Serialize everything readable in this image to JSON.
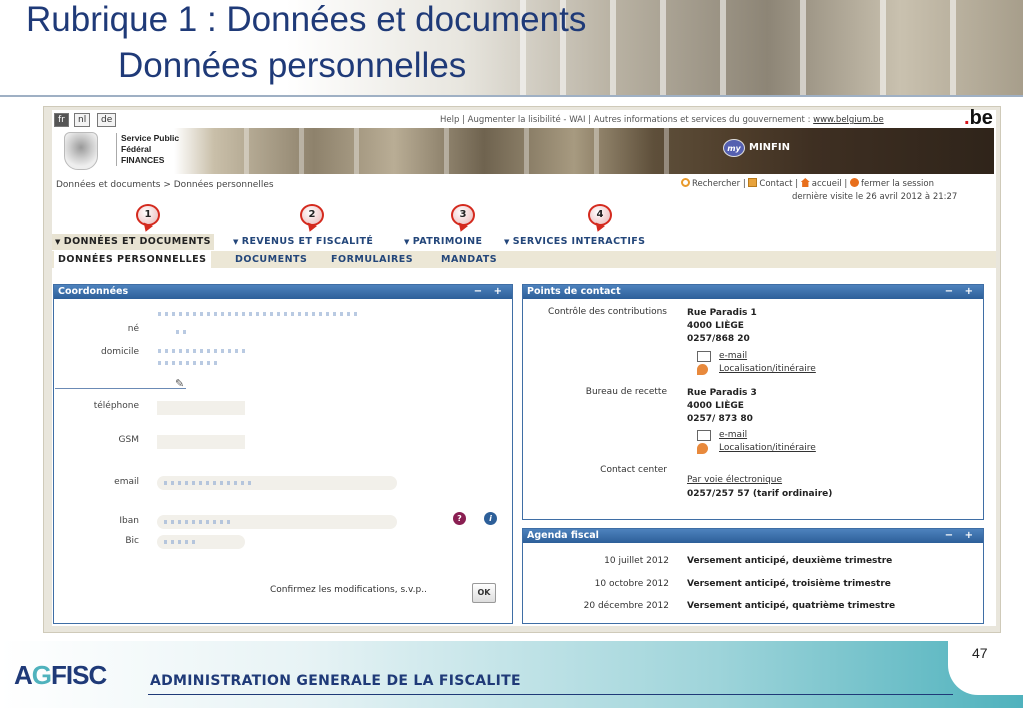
{
  "slide": {
    "title": "Rubrique 1 : Données et documents",
    "subtitle": "Données personnelles",
    "number": "47",
    "footer_logo": "AGFISC",
    "footer_agency": "ADMINISTRATION GENERALE DE LA FISCALITE"
  },
  "site": {
    "languages": [
      "fr",
      "nl",
      "de"
    ],
    "active_language": "fr",
    "top_links": "Help | Augmenter la lisibilité - WAI | Autres informations et services du gouvernement :",
    "gov_link": "www.belgium.be",
    "be_logo": ".be",
    "spf_lines": [
      "Service Public",
      "Fédéral",
      "FINANCES"
    ],
    "minfin_label": "MINFIN",
    "breadcrumb": "Données et documents > Données personnelles",
    "util_links": [
      "Rechercher",
      "Contact",
      "accueil",
      "fermer la session"
    ],
    "last_visit": "dernière visite le 26 avril 2012 à 21:27"
  },
  "nav": {
    "main": [
      "DONNÉES ET DOCUMENTS",
      "REVENUS ET FISCALITÉ",
      "PATRIMOINE",
      "SERVICES INTERACTIFS"
    ],
    "active_main": "DONNÉES ET DOCUMENTS",
    "sub": [
      "DONNÉES PERSONNELLES",
      "DOCUMENTS",
      "FORMULAIRES",
      "MANDATS"
    ],
    "active_sub": "DONNÉES PERSONNELLES",
    "callouts": [
      "1",
      "2",
      "3",
      "4"
    ]
  },
  "coordonnees": {
    "title": "Coordonnées",
    "controls": "− +",
    "labels": {
      "ne": "né",
      "domicile": "domicile",
      "telephone": "téléphone",
      "gsm": "GSM",
      "email": "email",
      "iban": "Iban",
      "bic": "Bic"
    },
    "confirm_text": "Confirmez les modifications, s.v.p..",
    "ok_label": "OK"
  },
  "contact": {
    "title": "Points de contact",
    "controls": "− +",
    "entries": [
      {
        "label": "Contrôle des contributions",
        "lines": [
          "Rue Paradis 1",
          "4000 LIÈGE",
          "0257/868 20"
        ],
        "links": [
          "e-mail",
          "Localisation/itinéraire"
        ]
      },
      {
        "label": "Bureau de recette",
        "lines": [
          "Rue Paradis 3",
          "4000 LIÈGE",
          "0257/ 873 80"
        ],
        "links": [
          "e-mail",
          "Localisation/itinéraire"
        ]
      },
      {
        "label": "Contact center",
        "link": "Par voie électronique",
        "phone": "0257/257 57 (tarif ordinaire)"
      }
    ]
  },
  "agenda": {
    "title": "Agenda fiscal",
    "controls": "− +",
    "rows": [
      {
        "date": "10 juillet 2012",
        "text": "Versement anticipé, deuxième trimestre"
      },
      {
        "date": "10 octobre 2012",
        "text": "Versement anticipé, troisième trimestre"
      },
      {
        "date": "20 décembre 2012",
        "text": "Versement anticipé, quatrième trimestre"
      }
    ]
  },
  "colors": {
    "title_blue": "#1f3a78",
    "panel_blue": "#3f6ea5",
    "nav_blue": "#23467a",
    "callout_red": "#d42a1e",
    "footer_teal": "#4fb2bd"
  }
}
